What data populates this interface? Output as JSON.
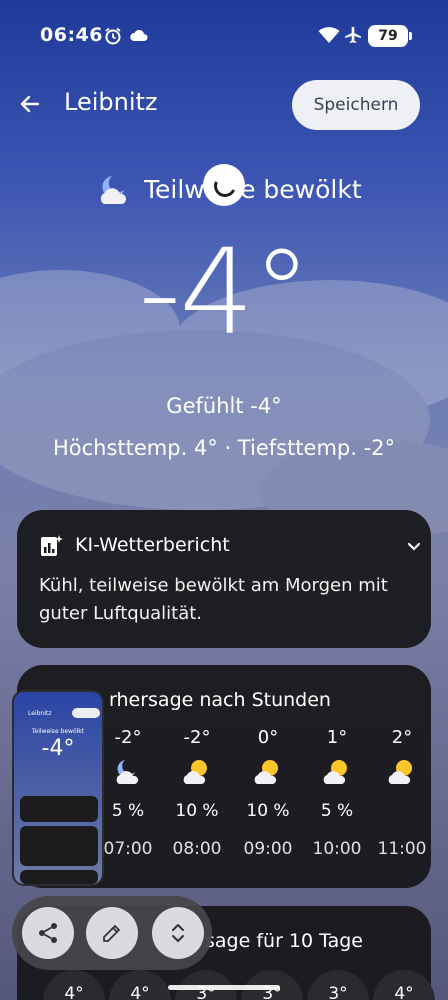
{
  "status_bar": {
    "time": "06:46",
    "battery": "79"
  },
  "header": {
    "location": "Leibnitz",
    "save_label": "Speichern"
  },
  "current": {
    "condition": "Teilweise bewölkt",
    "temperature": "-4°",
    "feels_like": "Gefühlt -4°",
    "high_low": "Höchsttemp. 4° · Tiefsttemp. -2°"
  },
  "ai_report": {
    "title": "KI-Wetterbericht",
    "text": "Kühl, teilweise bewölkt am Morgen mit guter Luftqualität."
  },
  "hourly": {
    "title": "Vorhersage nach Stunden",
    "title_visible": "rhersage nach Stunden",
    "items": [
      {
        "temp": "-2°",
        "icon": "moon-cloud-icon",
        "precip": "5 %",
        "time": "07:00"
      },
      {
        "temp": "-2°",
        "icon": "sun-cloud-icon",
        "precip": "10 %",
        "time": "08:00"
      },
      {
        "temp": "0°",
        "icon": "sun-cloud-icon",
        "precip": "10 %",
        "time": "09:00"
      },
      {
        "temp": "1°",
        "icon": "sun-cloud-icon",
        "precip": "5 %",
        "time": "10:00"
      },
      {
        "temp": "2°",
        "icon": "sun-cloud-icon",
        "precip": "",
        "time": "11:00"
      }
    ]
  },
  "ten_day": {
    "title_visible": "sage für 10 Tage",
    "pills": [
      "4°",
      "4°",
      "3°",
      "3°",
      "3°",
      "4°"
    ]
  },
  "thumbnail": {
    "title": "Leibnitz",
    "condition": "Teilweise bewölkt",
    "temp": "-4°"
  },
  "colors": {
    "card_bg": "#161618",
    "accent_bg_top": "#1f3a99"
  }
}
